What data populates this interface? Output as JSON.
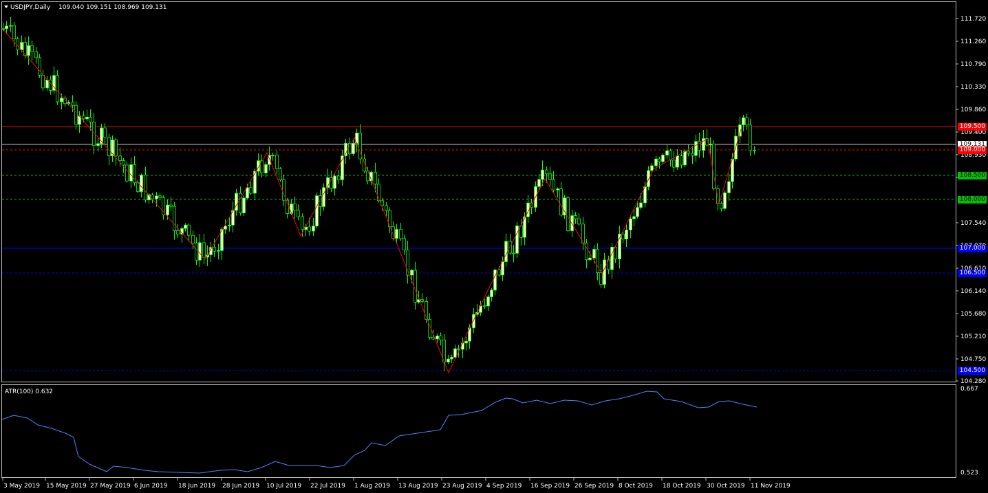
{
  "main": {
    "symbol_title": "USDJPY,Daily",
    "ohlc_text": "109.040 109.151 108.969 109.131",
    "price_ticks": [
      "111.720",
      "111.260",
      "110.790",
      "110.330",
      "109.860",
      "109.400",
      "108.930",
      "108.470",
      "107.540",
      "107.070",
      "106.610",
      "106.140",
      "105.680",
      "105.210",
      "104.750",
      "104.280"
    ],
    "date_ticks": [
      "3 May 2019",
      "15 May 2019",
      "27 May 2019",
      "6 Jun 2019",
      "18 Jun 2019",
      "28 Jun 2019",
      "10 Jul 2019",
      "22 Jul 2019",
      "1 Aug 2019",
      "13 Aug 2019",
      "23 Aug 2019",
      "4 Sep 2019",
      "16 Sep 2019",
      "26 Sep 2019",
      "8 Oct 2019",
      "18 Oct 2019",
      "30 Oct 2019",
      "11 Nov 2019"
    ],
    "price_labels": [
      {
        "text": "109.500",
        "bg": "#ff0000",
        "fg": "#ffffff"
      },
      {
        "text": "109.131",
        "bg": "#ffffff",
        "fg": "#000000"
      },
      {
        "text": "109.000",
        "bg": "#ff0000",
        "fg": "#ffffff"
      },
      {
        "text": "108.500",
        "bg": "#00c000",
        "fg": "#000000"
      },
      {
        "text": "108.000",
        "bg": "#00c000",
        "fg": "#000000"
      },
      {
        "text": "107.000",
        "bg": "#0000ff",
        "fg": "#ffffff"
      },
      {
        "text": "106.500",
        "bg": "#0000ff",
        "fg": "#ffffff"
      },
      {
        "text": "104.500",
        "bg": "#0000ff",
        "fg": "#ffffff"
      }
    ]
  },
  "indicator": {
    "title": "ATR(100) 0.632",
    "ticks": [
      "0.667",
      "0.523"
    ]
  },
  "colors": {
    "background": "#000000",
    "bull_candle": "#ffffcc",
    "bear_candle": "#000000",
    "wick": "#00ff00",
    "zigzag": "#ff0000",
    "atr_line": "#4488ff",
    "resistance": "#ff0000",
    "support_green": "#00c000",
    "support_blue": "#0000ff"
  }
}
